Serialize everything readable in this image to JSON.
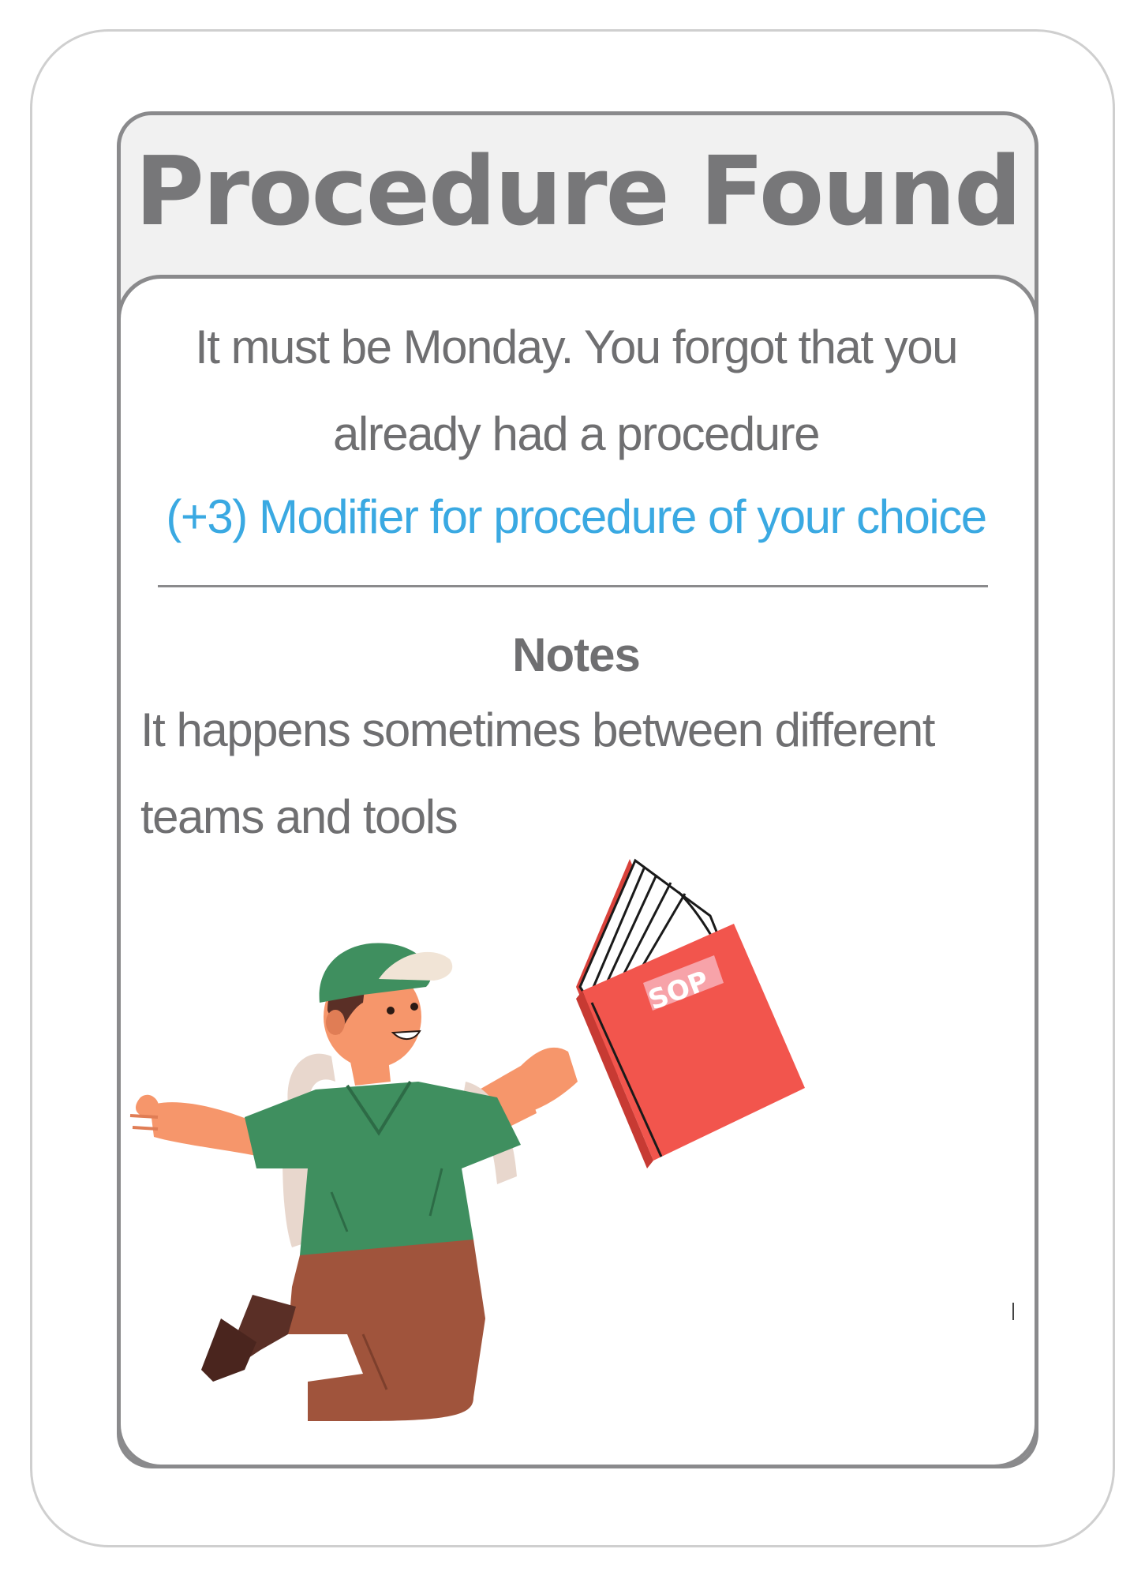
{
  "card": {
    "title": "Procedure Found",
    "description": "It must be Monday. You forgot that you already had a procedure",
    "modifier": "(+3) Modifier for procedure of your choice",
    "notes_heading": "Notes",
    "notes_text": "It happens sometimes between different teams and tools",
    "book_label": "SOP"
  },
  "colors": {
    "title": "#777779",
    "body_text": "#6f6f71",
    "modifier": "#3aa9e2",
    "frame_border": "#8a8a8c",
    "book": "#f2554d"
  }
}
